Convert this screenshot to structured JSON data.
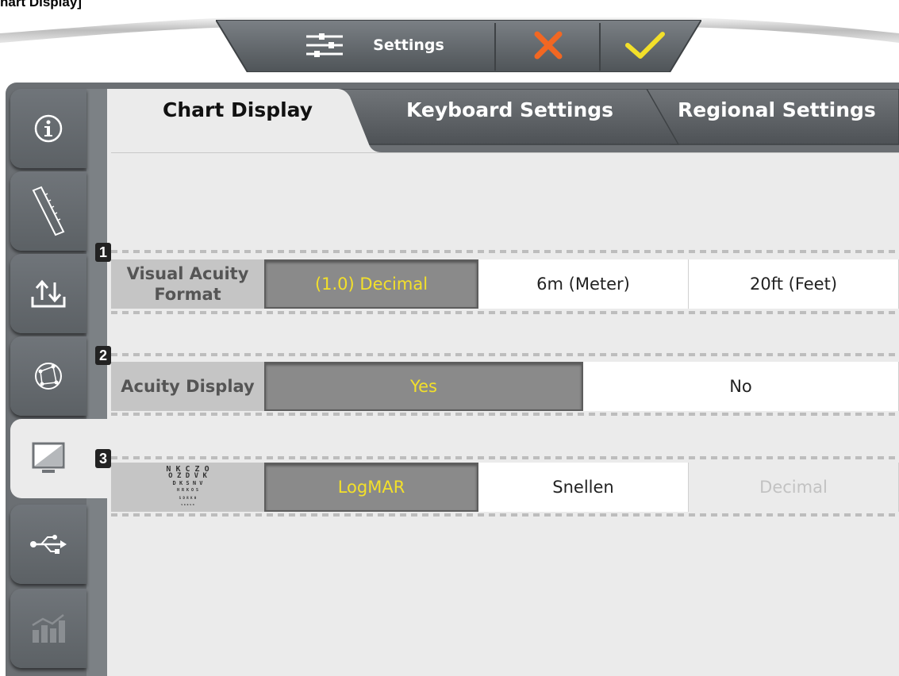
{
  "caption": "hart Display]",
  "toolbar": {
    "title": "Settings",
    "icons": [
      "sliders-icon",
      "close-icon",
      "check-icon"
    ],
    "colors": {
      "cancel": "#f26722",
      "confirm": "#f3e02a"
    }
  },
  "tabs": [
    {
      "label": "Chart Display",
      "active": true
    },
    {
      "label": "Keyboard Settings",
      "active": false
    },
    {
      "label": "Regional Settings",
      "active": false
    }
  ],
  "sidebar": {
    "items": [
      {
        "icon": "info-icon"
      },
      {
        "icon": "ruler-icon"
      },
      {
        "icon": "import-export-icon"
      },
      {
        "icon": "network-icon"
      },
      {
        "icon": "display-icon",
        "active": true
      },
      {
        "icon": "usb-icon"
      },
      {
        "icon": "statistics-icon"
      }
    ]
  },
  "rows": [
    {
      "number": "1",
      "label": "Visual Acuity Format",
      "options": [
        {
          "label": "(1.0) Decimal",
          "selected": true
        },
        {
          "label": "6m (Meter)",
          "selected": false
        },
        {
          "label": "20ft (Feet)",
          "selected": false
        }
      ]
    },
    {
      "number": "2",
      "label": "Acuity Display",
      "options": [
        {
          "label": "Yes",
          "selected": true
        },
        {
          "label": "No",
          "selected": false
        }
      ]
    },
    {
      "number": "3",
      "chart_icon_lines": [
        "N K C Z O",
        "O Z D V K",
        "D K S N V",
        "H R K O S",
        "S D R K H",
        "V K R S H"
      ],
      "options": [
        {
          "label": "LogMAR",
          "selected": true
        },
        {
          "label": "Snellen",
          "selected": false
        },
        {
          "label": "Decimal",
          "selected": false,
          "disabled": true
        }
      ]
    }
  ],
  "colors": {
    "selected_text": "#f3e02a",
    "selected_bg": "#8a8a8a",
    "panel_bg": "#ebebeb",
    "frame": "#6b6f73"
  }
}
